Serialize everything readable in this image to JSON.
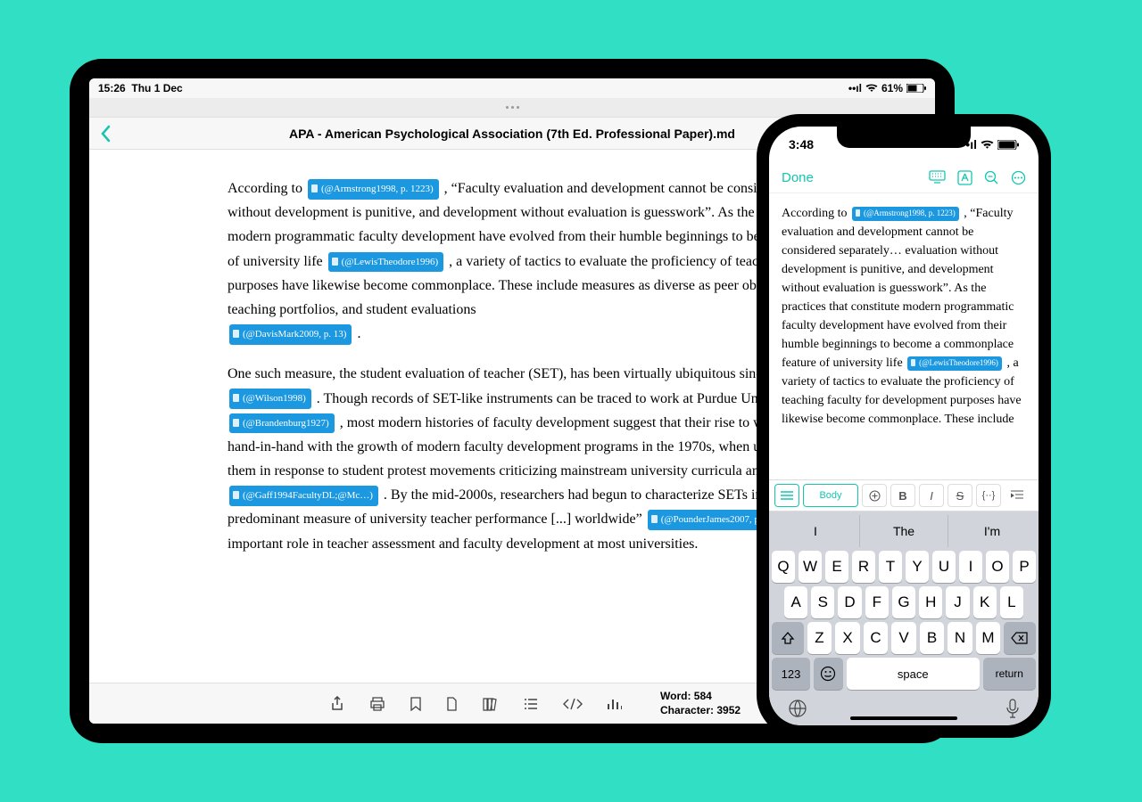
{
  "ipad": {
    "status": {
      "time": "15:26",
      "date": "Thu 1 Dec",
      "battery": "61%"
    },
    "title": "APA - American Psychological Association (7th Ed. Professional Paper).md",
    "para1": {
      "t1": "According to ",
      "c1": "(@Armstrong1998, p. 1223)",
      "t2": ", “Faculty evaluation and development cannot be considered separately… evaluation without development is punitive, and development without evaluation is guesswork”. As the practices that constitute modern programmatic faculty development have evolved from their humble beginnings to become a commonplace feature of university life ",
      "c2": "(@LewisTheodore1996)",
      "t3": ", a variety of tactics to evaluate the proficiency of teaching faculty for development purposes have likewise become commonplace. These include measures as diverse as peer observations, the development of teaching portfolios, and student evaluations ",
      "c3": "(@DavisMark2009, p. 13)",
      "t4": " ."
    },
    "para2": {
      "t1": "One such measure, the student evaluation of teacher (SET), has been virtually ubiquitous since at least the 1990s ",
      "c1": "(@Wilson1998)",
      "t2": ". Though records of SET-like instruments can be traced to work at Purdue University in the 1920s ",
      "c2": "(@Brandenburg1927)",
      "t3": ", most modern histories of faculty development suggest that their rise to widespread popularity went hand-in-hand with the growth of modern faculty development programs in the 1970s, when universities began to adopt them in response to student protest movements criticizing mainstream university curricula and approaches to instruction ",
      "c3": "(@Gaff1994FacultyDL;@Mc…)",
      "t4": ". By the mid-2000s, researchers had begun to characterize SETs in terms like “...the predominant measure of university teacher performance [...] worldwide” ",
      "c4": "(@PounderJames2007, p. 178)",
      "t5": ". Today, SETs play an important role in teacher assessment and faculty development at most universities."
    },
    "counts": {
      "word_label": "Word: 584",
      "char_label": "Character: 3952"
    }
  },
  "iphone": {
    "status_time": "3:48",
    "done": "Done",
    "doc": {
      "t1": "According to ",
      "c1": "(@Armstrong1998, p. 1223)",
      "t2": ", “Faculty evaluation and development cannot be considered separately… evaluation without development is punitive, and development without evaluation is guesswork”. As the practices that constitute modern programmatic faculty development have evolved from their humble beginnings to become a commonplace feature of university life ",
      "c2": "(@LewisTheodore1996)",
      "t3": ", a variety of tactics to evaluate the proficiency of teaching faculty for development purposes have likewise become commonplace. These include"
    },
    "fmt_body": "Body",
    "suggestions": [
      "I",
      "The",
      "I'm"
    ],
    "keys_r1": [
      "Q",
      "W",
      "E",
      "R",
      "T",
      "Y",
      "U",
      "I",
      "O",
      "P"
    ],
    "keys_r2": [
      "A",
      "S",
      "D",
      "F",
      "G",
      "H",
      "J",
      "K",
      "L"
    ],
    "keys_r3": [
      "Z",
      "X",
      "C",
      "V",
      "B",
      "N",
      "M"
    ],
    "num": "123",
    "space": "space",
    "return": "return"
  }
}
